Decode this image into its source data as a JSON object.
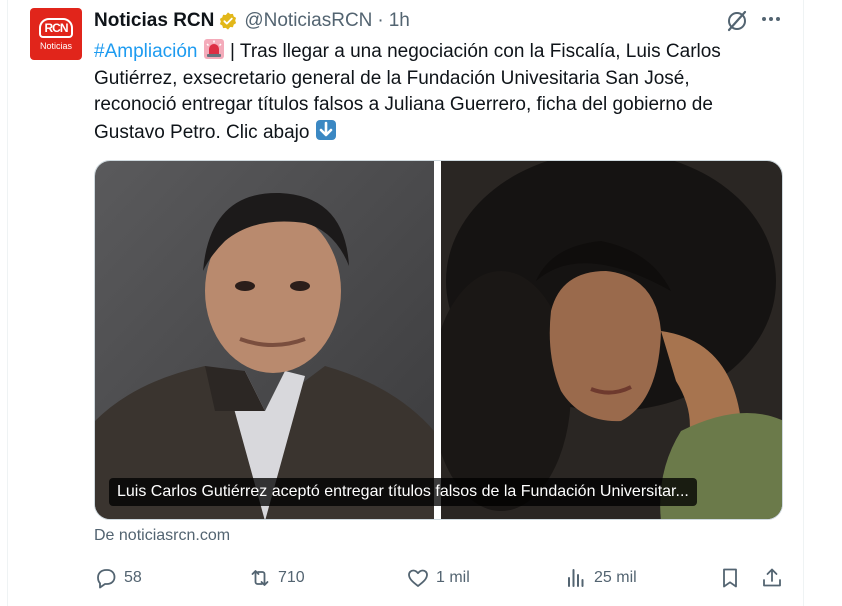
{
  "post": {
    "author_name": "Noticias RCN",
    "handle": "@NoticiasRCN",
    "separator": "·",
    "time": "1h",
    "avatar": {
      "mark": "RCN",
      "word": "Noticias",
      "color": "#e1251b"
    },
    "text_lines": {
      "l1_hashtag": "#Ampliación",
      "l1_rest": " | Tras llegar a una negociación con la Fiscalía, Luis Carlos",
      "l2": "Gutiérrez, exsecretario general de la Fundación Univesitaria San José,",
      "l3": "reconoció entregar títulos falsos a Juliana Guerrero, ficha del gobierno de",
      "l4": "Gustavo Petro. Clic abajo "
    },
    "emojis": [
      "rotating-light-icon",
      "down-arrow-icon"
    ],
    "link_card": {
      "caption": "Luis Carlos Gutiérrez aceptó entregar títulos falsos de la Fundación Universitar...",
      "source": "De noticiasrcn.com"
    },
    "metrics": {
      "replies": "58",
      "reposts": "710",
      "likes": "1 mil",
      "views": "25 mil"
    },
    "icons": [
      "verified-badge-icon",
      "grok-icon",
      "more-icon",
      "reply-icon",
      "retweet-icon",
      "heart-icon",
      "views-icon",
      "bookmark-icon",
      "share-icon"
    ]
  },
  "colors": {
    "accent": "#1d9bf0",
    "text_primary": "#0f1419",
    "text_secondary": "#536471",
    "verified_gold": "#e2b719"
  }
}
